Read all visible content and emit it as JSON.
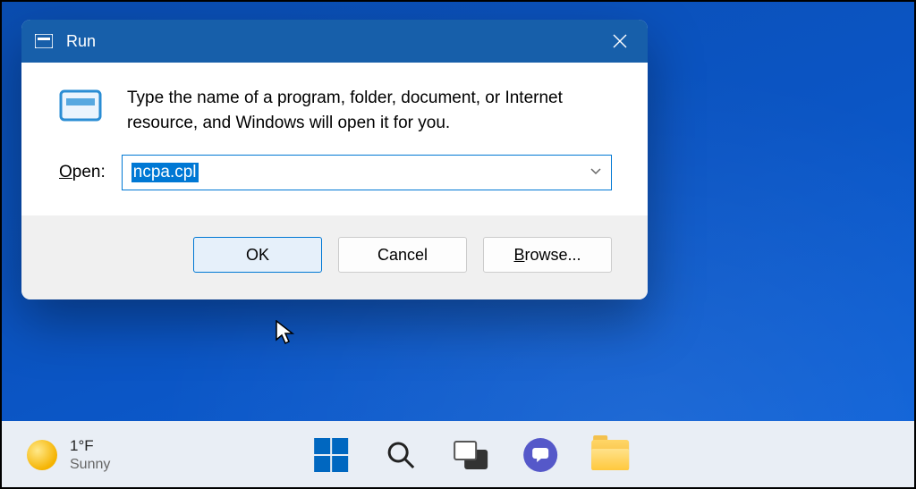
{
  "dialog": {
    "title": "Run",
    "description": "Type the name of a program, folder, document, or Internet resource, and Windows will open it for you.",
    "open_label_prefix": "O",
    "open_label_rest": "pen:",
    "input_value": "ncpa.cpl",
    "buttons": {
      "ok": "OK",
      "cancel": "Cancel",
      "browse_prefix": "B",
      "browse_rest": "rowse..."
    }
  },
  "taskbar": {
    "weather": {
      "temp": "1°F",
      "condition": "Sunny"
    }
  }
}
